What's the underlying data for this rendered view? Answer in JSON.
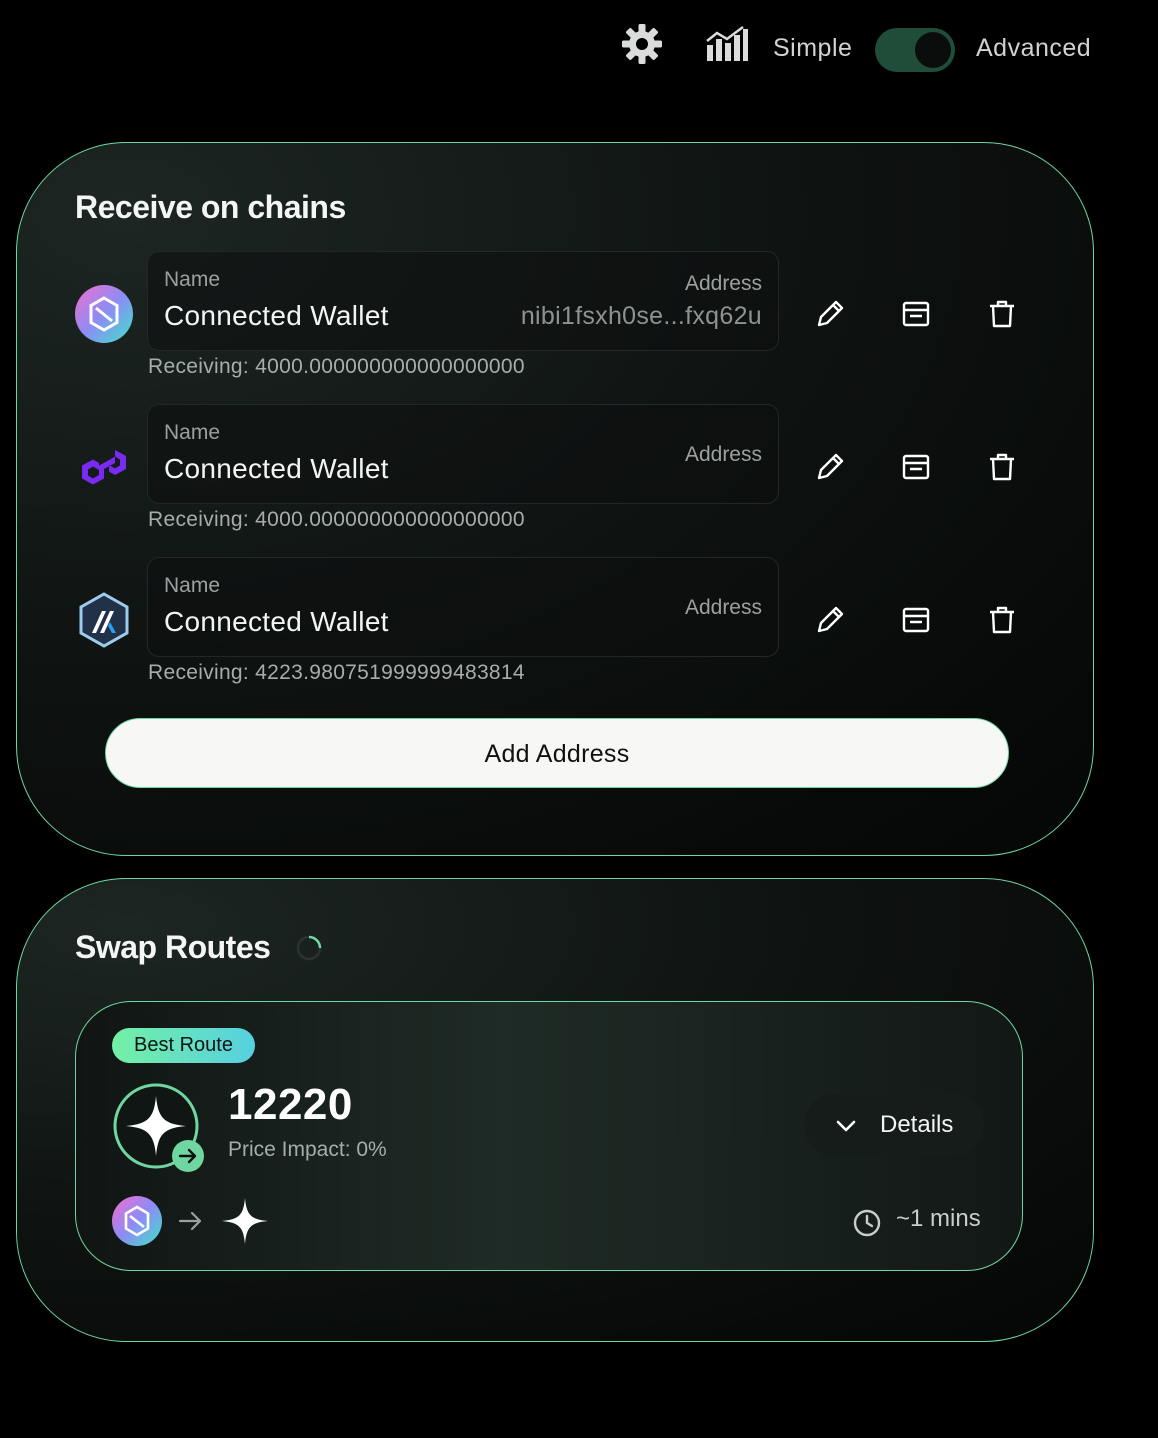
{
  "topbar": {
    "settings_icon": "gear-icon",
    "chart_icon": "chart-icon",
    "mode_simple": "Simple",
    "mode_advanced": "Advanced",
    "toggle_state": "advanced"
  },
  "receive": {
    "title": "Receive on chains",
    "rows": [
      {
        "chain_icon": "nibiru-icon",
        "name_label": "Name",
        "name_value": "Connected Wallet",
        "address_label": "Address",
        "address_value": "nibi1fsxh0se...fxq62u",
        "receiving": "Receiving: 4000.000000000000000000"
      },
      {
        "chain_icon": "polygon-icon",
        "name_label": "Name",
        "name_value": "Connected Wallet",
        "address_label": "Address",
        "address_value": "",
        "receiving": "Receiving: 4000.000000000000000000"
      },
      {
        "chain_icon": "arbitrum-icon",
        "name_label": "Name",
        "name_value": "Connected Wallet",
        "address_label": "Address",
        "address_value": "",
        "receiving": "Receiving: 4223.980751999999483814"
      }
    ],
    "add_button": "Add Address"
  },
  "swap": {
    "title": "Swap Routes",
    "route": {
      "badge": "Best Route",
      "amount": "12220",
      "price_impact": "Price Impact: 0%",
      "details_label": "Details",
      "time": "~1 mins"
    }
  },
  "colors": {
    "accent": "#6fd6a2",
    "toggle_bg": "#1f4d3a",
    "badge_start": "#74f0a6",
    "badge_end": "#56d0e0"
  }
}
